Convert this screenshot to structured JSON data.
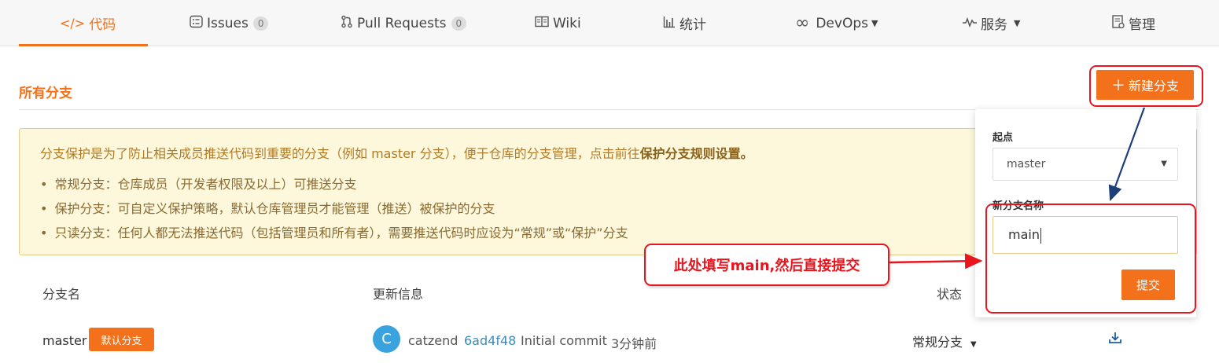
{
  "nav": {
    "tabs": [
      {
        "label": "代码",
        "icon": "code-icon"
      },
      {
        "label": "Issues",
        "count": "0",
        "icon": "issues-icon"
      },
      {
        "label": "Pull Requests",
        "count": "0",
        "icon": "pull-request-icon"
      },
      {
        "label": "Wiki",
        "icon": "book-icon"
      },
      {
        "label": "统计",
        "icon": "bar-chart-icon"
      },
      {
        "label": "DevOps",
        "icon": "infinity-icon"
      },
      {
        "label": "服务",
        "icon": "pulse-icon"
      },
      {
        "label": "管理",
        "icon": "settings-doc-icon"
      }
    ],
    "active_index": 0
  },
  "section": {
    "title": "所有分支",
    "new_branch_label": "新建分支"
  },
  "notice": {
    "text_before": "分支保护是为了防止相关成员推送代码到重要的分支（例如 master 分支），便于仓库的分支管理，点击前往",
    "link": "保护分支规则设置。",
    "items": [
      "常规分支：仓库成员（开发者权限及以上）可推送分支",
      "保护分支：可自定义保护策略，默认仓库管理员才能管理（推送）被保护的分支",
      "只读分支：任何人都无法推送代码（包括管理员和所有者），需要推送代码时应设为“常规”或“保护”分支"
    ]
  },
  "table": {
    "headers": {
      "name": "分支名",
      "update": "更新信息",
      "status": "状态"
    },
    "rows": [
      {
        "name": "master",
        "badge": "默认分支",
        "avatar": "C",
        "user": "catzend",
        "sha": "6ad4f48",
        "message": "Initial commit",
        "time": "3分钟前",
        "status": "常规分支"
      }
    ]
  },
  "popover": {
    "origin_label": "起点",
    "origin_value": "master",
    "name_label": "新分支名称",
    "name_value": "main",
    "submit_label": "提交"
  },
  "annotation": {
    "text": "此处填写main,然后直接提交"
  },
  "colors": {
    "accent": "#f3711a",
    "annotation": "#e8151f",
    "arrow_blue": "#1c3f7a",
    "notice_bg": "#fdf8dc",
    "sha_link": "#3a8bbd"
  }
}
